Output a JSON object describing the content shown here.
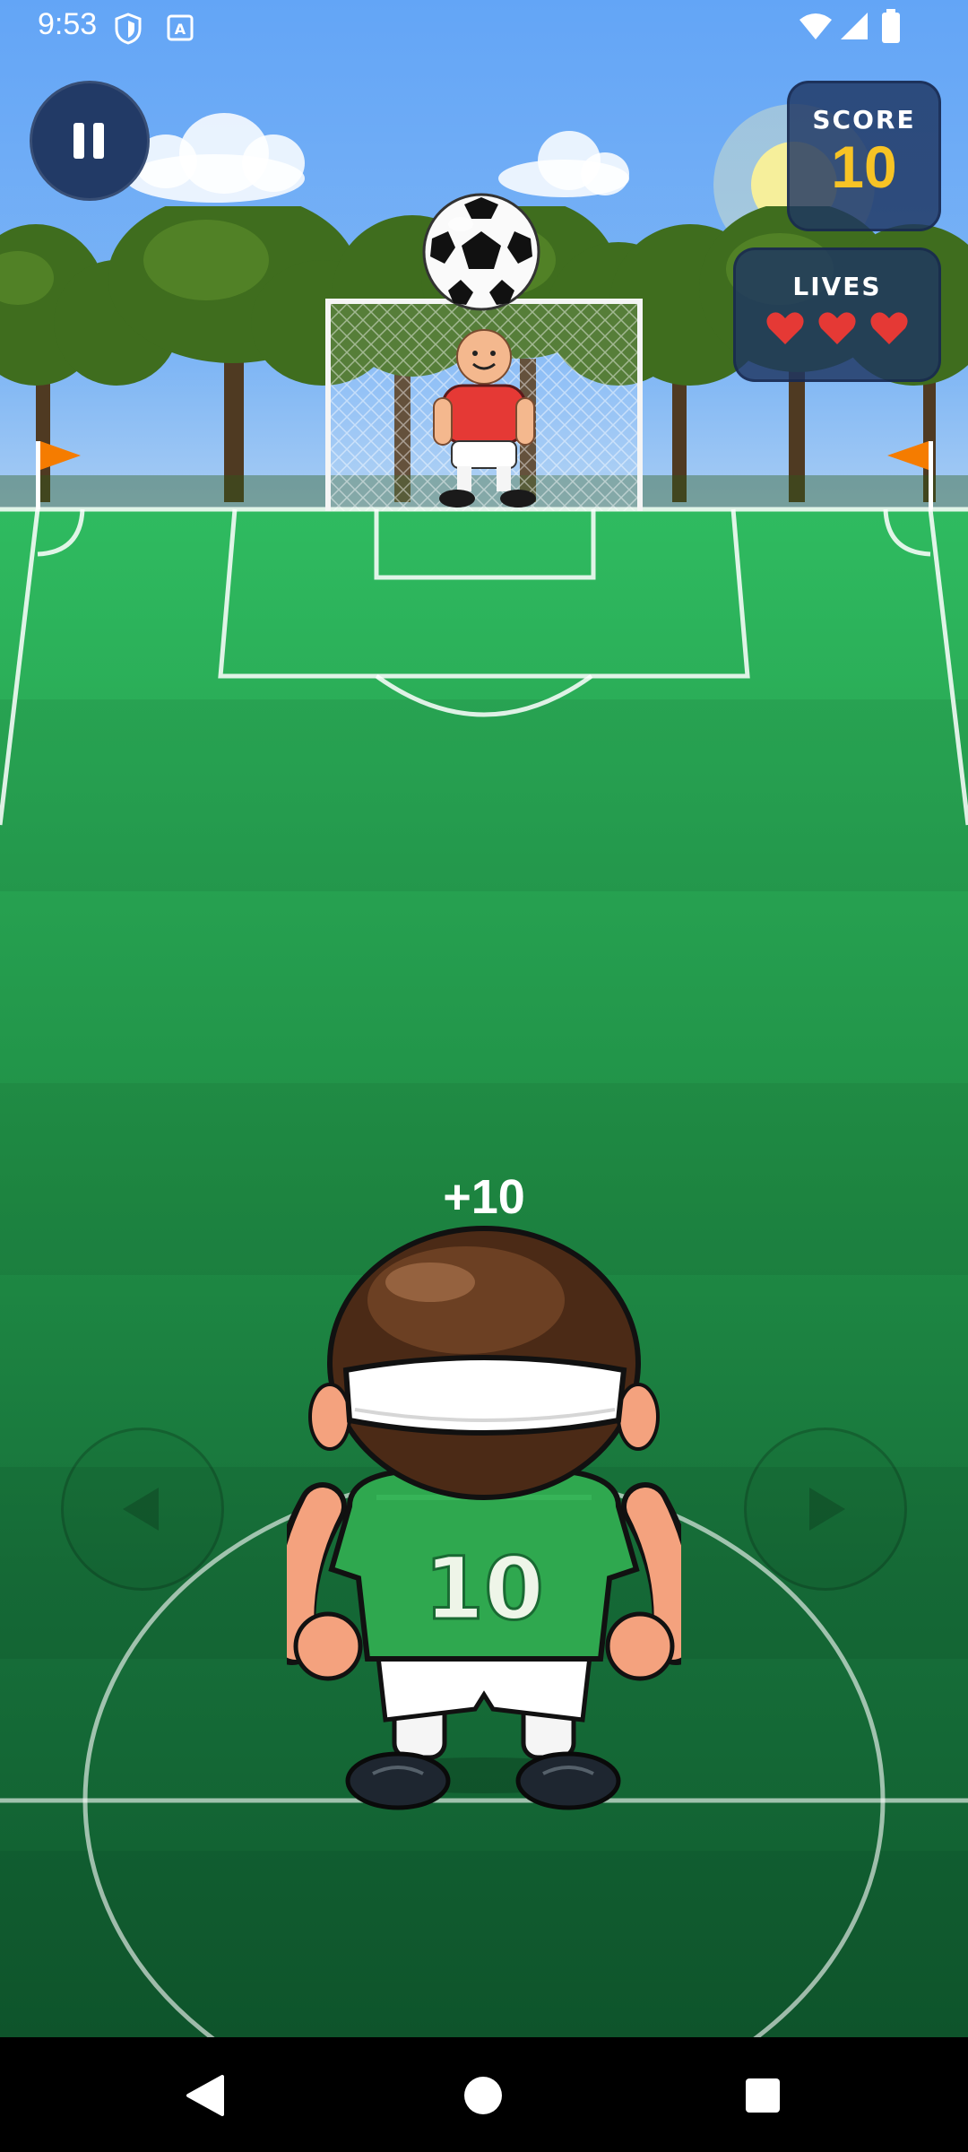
{
  "status_bar": {
    "time": "9:53",
    "left_icons": [
      "shield-icon",
      "font-app-icon"
    ],
    "right_icons": [
      "wifi-icon",
      "cell-signal-icon",
      "battery-icon"
    ]
  },
  "hud": {
    "score_label": "SCORE",
    "score_value": "10",
    "lives_label": "LIVES",
    "lives": 3,
    "score_color": "#f7c325",
    "heart_color": "#e53935"
  },
  "game": {
    "points_popup": "+10",
    "player_number": "10",
    "player_jersey_color": "#2fa84f",
    "keeper_jersey_color": "#e53935"
  },
  "nav_bar": {
    "buttons": [
      "back-icon",
      "home-icon",
      "recents-icon"
    ]
  }
}
